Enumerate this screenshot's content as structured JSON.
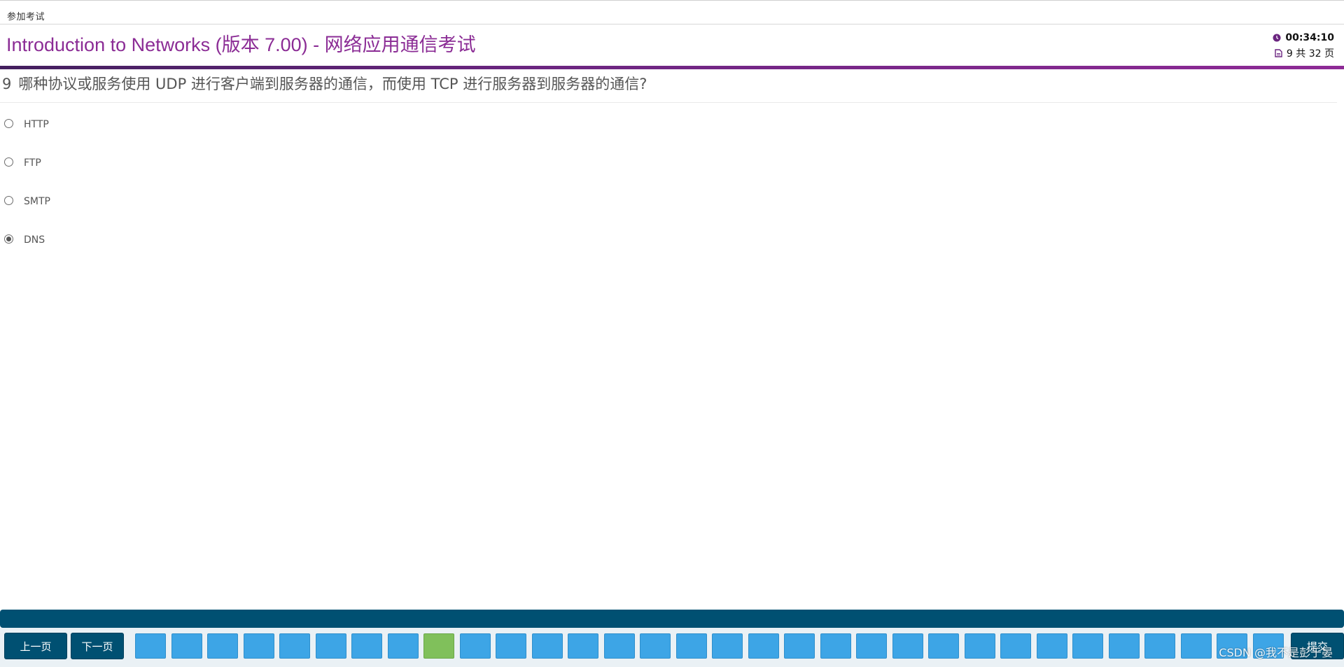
{
  "breadcrumb": "参加考试",
  "title": "Introduction to Networks (版本 7.00) - 网络应用通信考试",
  "timer": "00:34:10",
  "page_info": "9 共 32 页",
  "question": {
    "number": "9",
    "text": "哪种协议或服务使用 UDP 进行客户端到服务器的通信，而使用 TCP 进行服务器到服务器的通信?"
  },
  "options": [
    {
      "label": "HTTP",
      "selected": false
    },
    {
      "label": "FTP",
      "selected": false
    },
    {
      "label": "SMTP",
      "selected": false
    },
    {
      "label": "DNS",
      "selected": true
    }
  ],
  "nav": {
    "prev_label": "上一页",
    "next_label": "下一页",
    "submit_label": "提交",
    "total_boxes": 32,
    "current_box_index": 8
  },
  "watermark": "CSDN @我不是彭于晏",
  "colors": {
    "title": "#8b2c95",
    "nav_band": "#005072",
    "qbox": "#3da5e6",
    "qbox_current": "#80c05b"
  },
  "icons": [
    "clock-icon",
    "page-icon"
  ]
}
